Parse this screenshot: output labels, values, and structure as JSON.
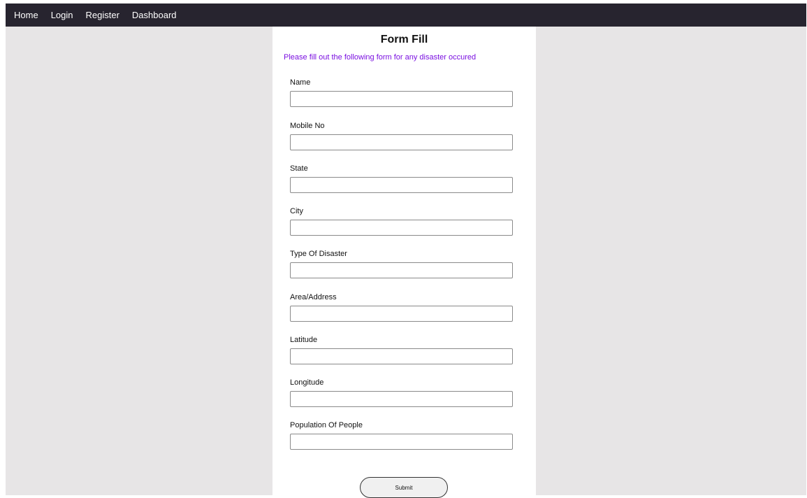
{
  "nav": {
    "items": [
      {
        "label": "Home"
      },
      {
        "label": "Login"
      },
      {
        "label": "Register"
      },
      {
        "label": "Dashboard"
      }
    ]
  },
  "form": {
    "title": "Form Fill",
    "subtitle": "Please fill out the following form for any disaster occured",
    "fields": [
      {
        "label": "Name",
        "value": ""
      },
      {
        "label": "Mobile No",
        "value": ""
      },
      {
        "label": "State",
        "value": ""
      },
      {
        "label": "City",
        "value": ""
      },
      {
        "label": "Type Of Disaster",
        "value": ""
      },
      {
        "label": "Area/Address",
        "value": ""
      },
      {
        "label": "Latitude",
        "value": ""
      },
      {
        "label": "Longitude",
        "value": ""
      },
      {
        "label": "Population Of People",
        "value": ""
      }
    ],
    "submit_label": "Submit"
  },
  "colors": {
    "navbar_bg": "#27242f",
    "page_bg": "#e7e5e6",
    "subtitle": "#7a0fe0"
  }
}
